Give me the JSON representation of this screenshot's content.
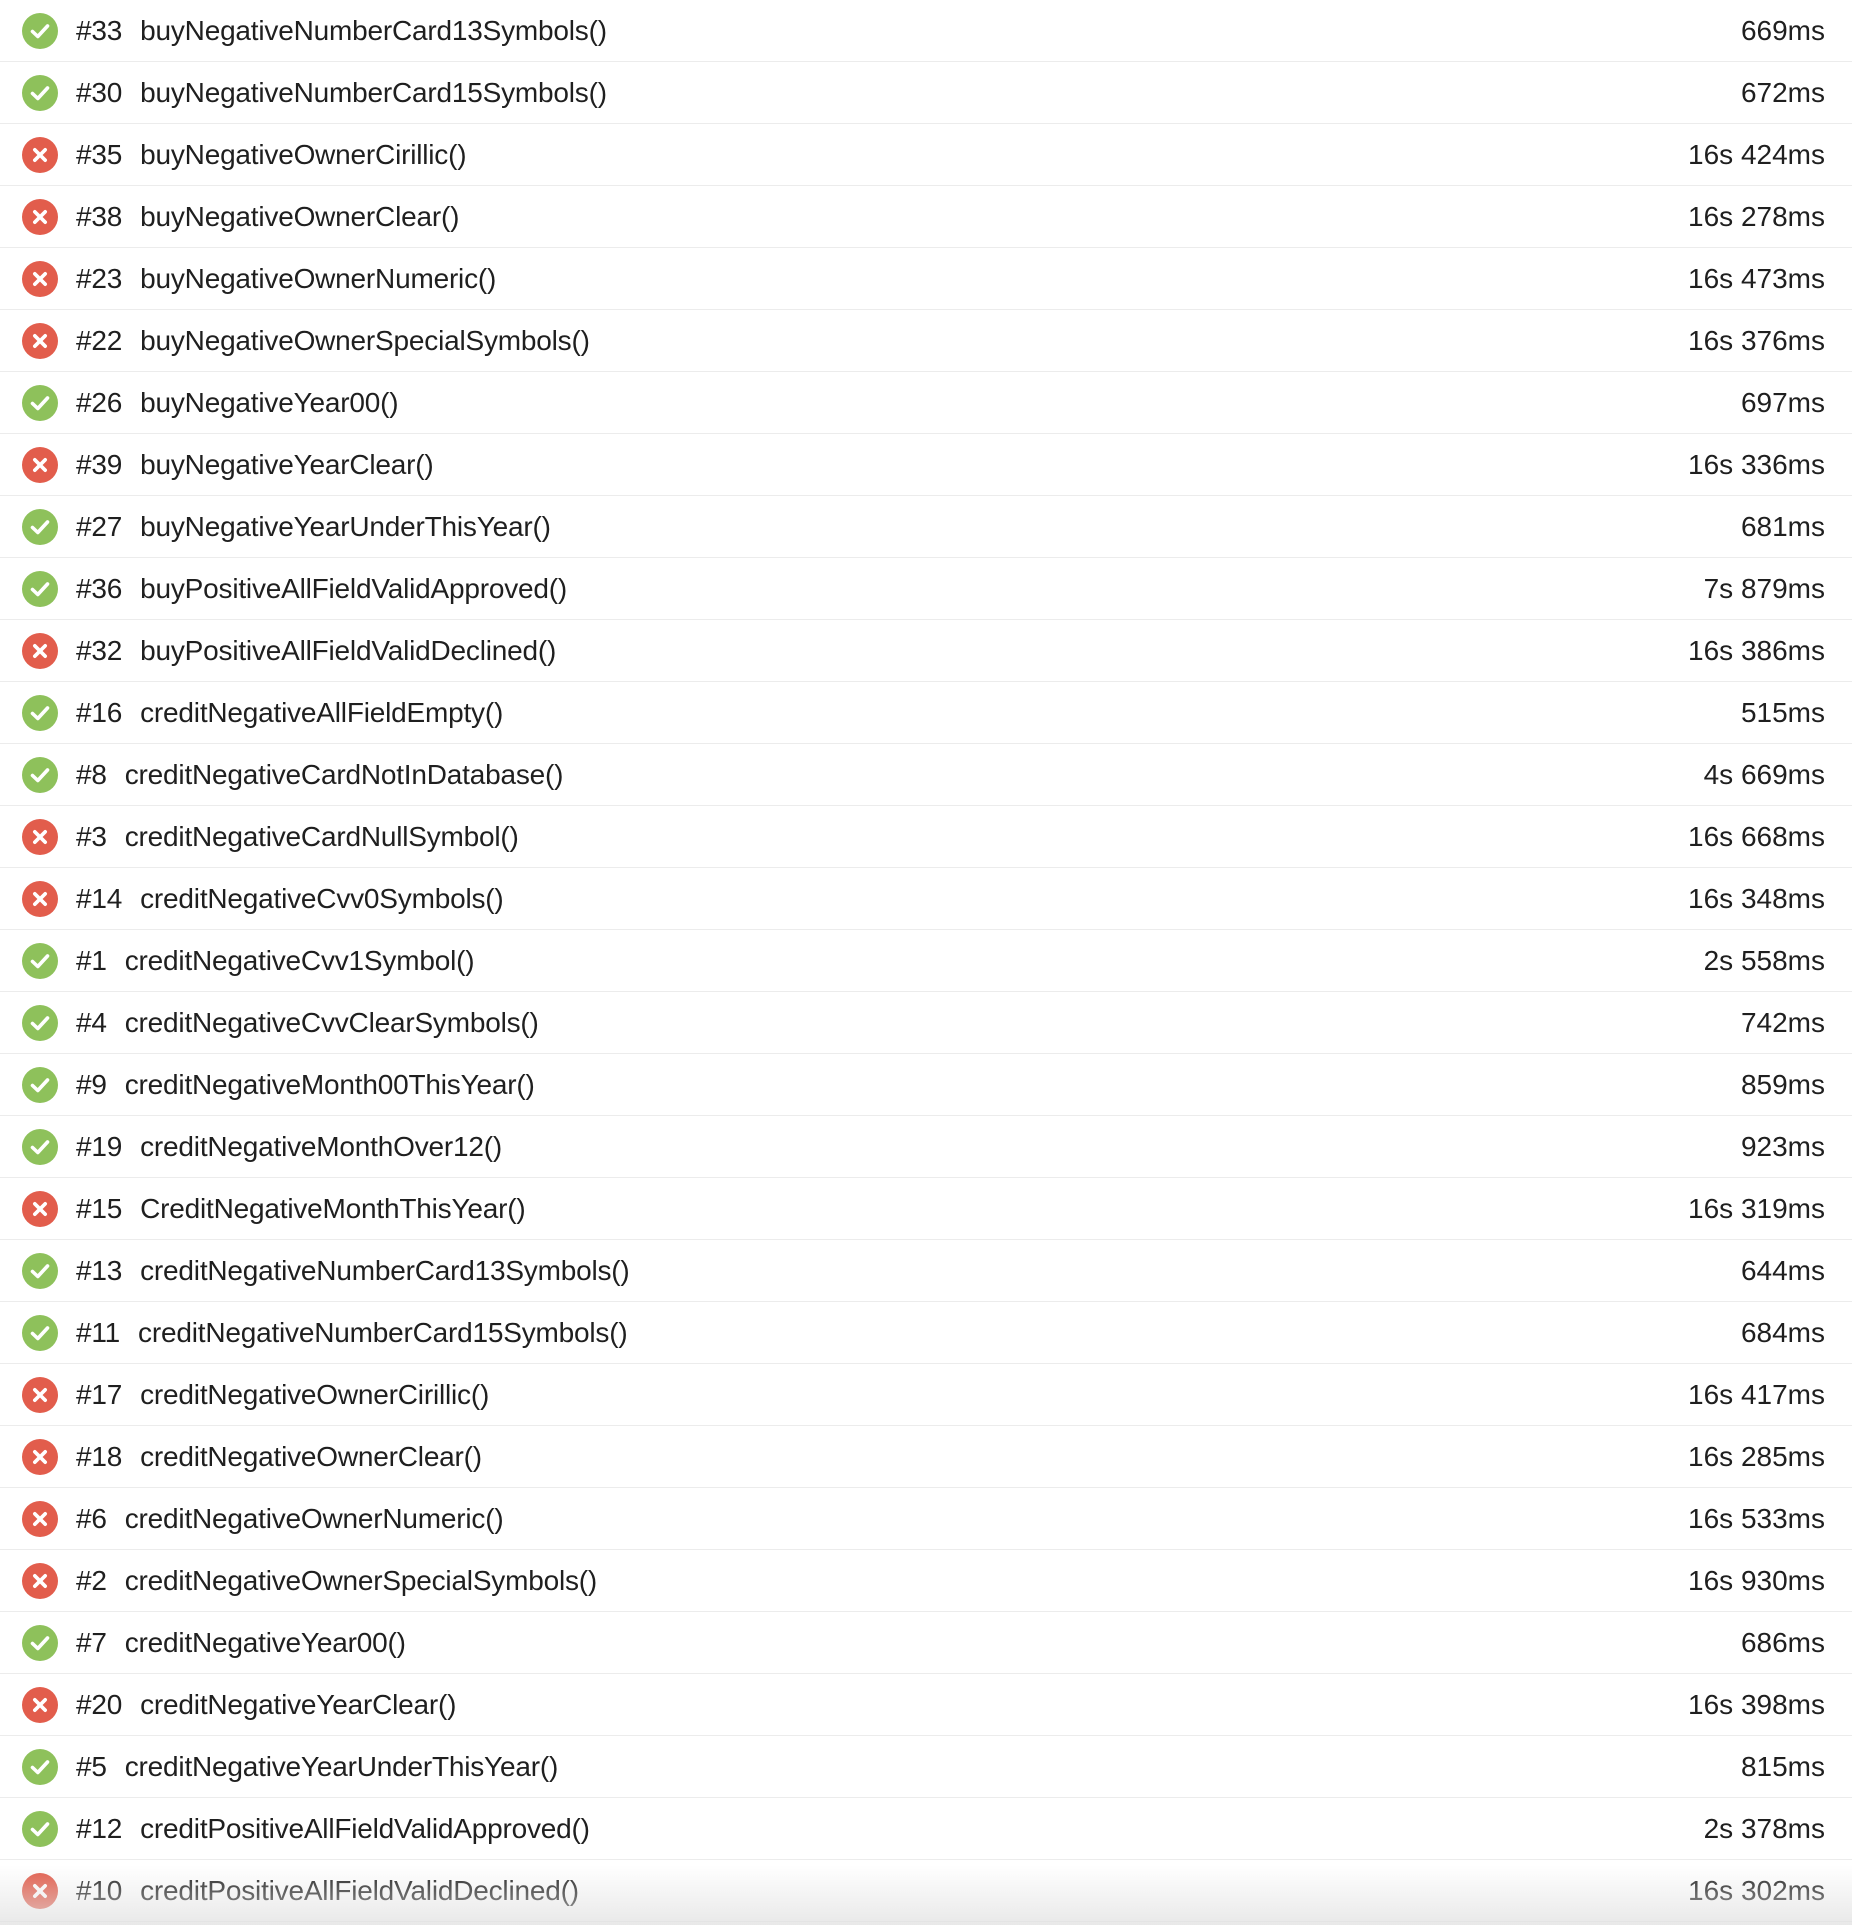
{
  "colors": {
    "passed": "#8ec15b",
    "failed": "#e25d4c",
    "divider": "#ececec",
    "text": "#1f1f1f"
  },
  "tests": [
    {
      "status": "passed",
      "icon": "check-circle-icon",
      "number": "#33",
      "name": "buyNegativeNumberCard13Symbols()",
      "duration": "669ms"
    },
    {
      "status": "passed",
      "icon": "check-circle-icon",
      "number": "#30",
      "name": "buyNegativeNumberCard15Symbols()",
      "duration": "672ms"
    },
    {
      "status": "failed",
      "icon": "cross-circle-icon",
      "number": "#35",
      "name": "buyNegativeOwnerCirillic()",
      "duration": "16s 424ms"
    },
    {
      "status": "failed",
      "icon": "cross-circle-icon",
      "number": "#38",
      "name": "buyNegativeOwnerClear()",
      "duration": "16s 278ms"
    },
    {
      "status": "failed",
      "icon": "cross-circle-icon",
      "number": "#23",
      "name": "buyNegativeOwnerNumeric()",
      "duration": "16s 473ms"
    },
    {
      "status": "failed",
      "icon": "cross-circle-icon",
      "number": "#22",
      "name": "buyNegativeOwnerSpecialSymbols()",
      "duration": "16s 376ms"
    },
    {
      "status": "passed",
      "icon": "check-circle-icon",
      "number": "#26",
      "name": "buyNegativeYear00()",
      "duration": "697ms"
    },
    {
      "status": "failed",
      "icon": "cross-circle-icon",
      "number": "#39",
      "name": "buyNegativeYearClear()",
      "duration": "16s 336ms"
    },
    {
      "status": "passed",
      "icon": "check-circle-icon",
      "number": "#27",
      "name": "buyNegativeYearUnderThisYear()",
      "duration": "681ms"
    },
    {
      "status": "passed",
      "icon": "check-circle-icon",
      "number": "#36",
      "name": "buyPositiveAllFieldValidApproved()",
      "duration": "7s 879ms"
    },
    {
      "status": "failed",
      "icon": "cross-circle-icon",
      "number": "#32",
      "name": "buyPositiveAllFieldValidDeclined()",
      "duration": "16s 386ms"
    },
    {
      "status": "passed",
      "icon": "check-circle-icon",
      "number": "#16",
      "name": "creditNegativeAllFieldEmpty()",
      "duration": "515ms"
    },
    {
      "status": "passed",
      "icon": "check-circle-icon",
      "number": "#8",
      "name": "creditNegativeCardNotInDatabase()",
      "duration": "4s 669ms"
    },
    {
      "status": "failed",
      "icon": "cross-circle-icon",
      "number": "#3",
      "name": "creditNegativeCardNullSymbol()",
      "duration": "16s 668ms"
    },
    {
      "status": "failed",
      "icon": "cross-circle-icon",
      "number": "#14",
      "name": "creditNegativeCvv0Symbols()",
      "duration": "16s 348ms"
    },
    {
      "status": "passed",
      "icon": "check-circle-icon",
      "number": "#1",
      "name": "creditNegativeCvv1Symbol()",
      "duration": "2s 558ms"
    },
    {
      "status": "passed",
      "icon": "check-circle-icon",
      "number": "#4",
      "name": "creditNegativeCvvClearSymbols()",
      "duration": "742ms"
    },
    {
      "status": "passed",
      "icon": "check-circle-icon",
      "number": "#9",
      "name": "creditNegativeMonth00ThisYear()",
      "duration": "859ms"
    },
    {
      "status": "passed",
      "icon": "check-circle-icon",
      "number": "#19",
      "name": "creditNegativeMonthOver12()",
      "duration": "923ms"
    },
    {
      "status": "failed",
      "icon": "cross-circle-icon",
      "number": "#15",
      "name": "CreditNegativeMonthThisYear()",
      "duration": "16s 319ms"
    },
    {
      "status": "passed",
      "icon": "check-circle-icon",
      "number": "#13",
      "name": "creditNegativeNumberCard13Symbols()",
      "duration": "644ms"
    },
    {
      "status": "passed",
      "icon": "check-circle-icon",
      "number": "#11",
      "name": "creditNegativeNumberCard15Symbols()",
      "duration": "684ms"
    },
    {
      "status": "failed",
      "icon": "cross-circle-icon",
      "number": "#17",
      "name": "creditNegativeOwnerCirillic()",
      "duration": "16s 417ms"
    },
    {
      "status": "failed",
      "icon": "cross-circle-icon",
      "number": "#18",
      "name": "creditNegativeOwnerClear()",
      "duration": "16s 285ms"
    },
    {
      "status": "failed",
      "icon": "cross-circle-icon",
      "number": "#6",
      "name": "creditNegativeOwnerNumeric()",
      "duration": "16s 533ms"
    },
    {
      "status": "failed",
      "icon": "cross-circle-icon",
      "number": "#2",
      "name": "creditNegativeOwnerSpecialSymbols()",
      "duration": "16s 930ms"
    },
    {
      "status": "passed",
      "icon": "check-circle-icon",
      "number": "#7",
      "name": "creditNegativeYear00()",
      "duration": "686ms"
    },
    {
      "status": "failed",
      "icon": "cross-circle-icon",
      "number": "#20",
      "name": "creditNegativeYearClear()",
      "duration": "16s 398ms"
    },
    {
      "status": "passed",
      "icon": "check-circle-icon",
      "number": "#5",
      "name": "creditNegativeYearUnderThisYear()",
      "duration": "815ms"
    },
    {
      "status": "passed",
      "icon": "check-circle-icon",
      "number": "#12",
      "name": "creditPositiveAllFieldValidApproved()",
      "duration": "2s 378ms"
    },
    {
      "status": "failed",
      "icon": "cross-circle-icon",
      "number": "#10",
      "name": "creditPositiveAllFieldValidDeclined()",
      "duration": "16s 302ms"
    }
  ]
}
